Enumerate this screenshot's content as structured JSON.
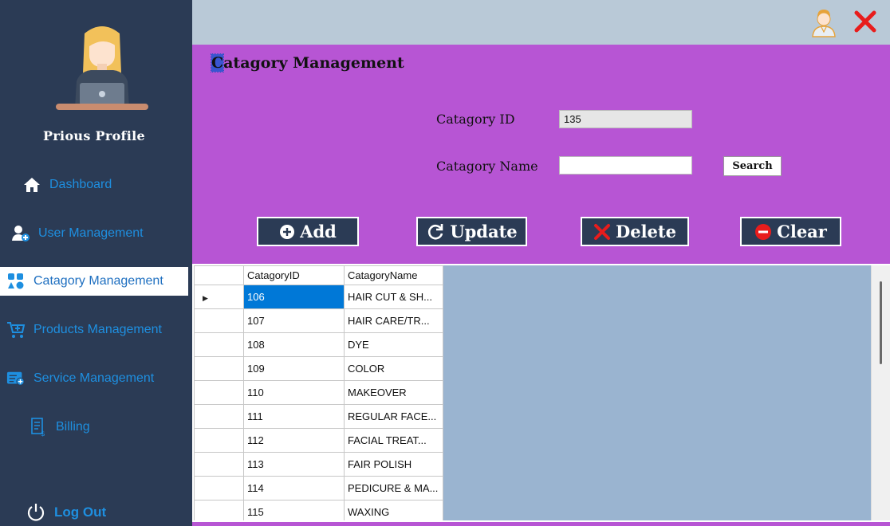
{
  "sidebar": {
    "profile_name": "Prious  Profile",
    "items": [
      {
        "label": "Dashboard",
        "icon": "home-icon"
      },
      {
        "label": "User Management",
        "icon": "user-add-icon"
      },
      {
        "label": "Catagory Management",
        "icon": "category-icon"
      },
      {
        "label": "Products Management",
        "icon": "cart-icon"
      },
      {
        "label": "Service Management",
        "icon": "service-icon"
      },
      {
        "label": "Billing",
        "icon": "bill-icon"
      }
    ],
    "logout_label": "Log Out"
  },
  "header": {
    "title_first": "C",
    "title_rest": "atagory Management"
  },
  "form": {
    "id_label": "Catagory ID",
    "id_value": "135",
    "name_label": "Catagory Name",
    "name_value": "",
    "search_label": "Search"
  },
  "actions": {
    "add_label": "Add",
    "update_label": "Update",
    "delete_label": "Delete",
    "clear_label": "Clear"
  },
  "grid": {
    "columns": [
      "CatagoryID",
      "CatagoryName"
    ],
    "rows": [
      [
        "106",
        "HAIR CUT & SH..."
      ],
      [
        "107",
        "HAIR CARE/TR..."
      ],
      [
        "108",
        "DYE"
      ],
      [
        "109",
        "COLOR"
      ],
      [
        "110",
        "MAKEOVER"
      ],
      [
        "111",
        "REGULAR FACE..."
      ],
      [
        "112",
        "FACIAL TREAT..."
      ],
      [
        "113",
        "FAIR POLISH"
      ],
      [
        "114",
        "PEDICURE & MA..."
      ],
      [
        "115",
        "WAXING"
      ]
    ]
  },
  "colors": {
    "sidebar_bg": "#2b3b55",
    "accent_blue": "#1e8fe0",
    "panel_purple": "#b755d4",
    "topbar": "#b9c9d7",
    "close_red": "#e81c1c"
  }
}
